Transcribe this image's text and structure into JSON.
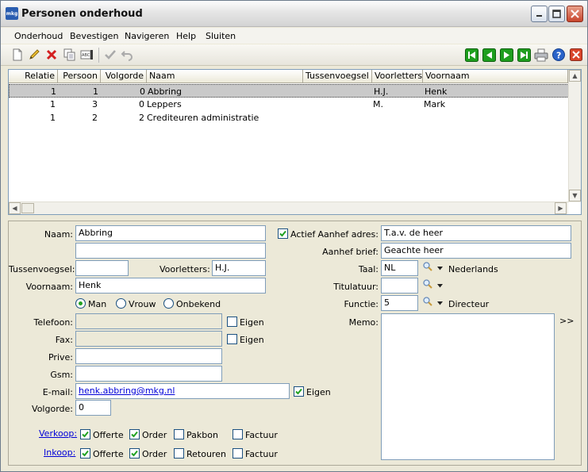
{
  "window": {
    "title": "Personen onderhoud",
    "app_icon_text": "mkg"
  },
  "menu": [
    "Onderhoud",
    "Bevestigen",
    "Navigeren",
    "Help",
    "Sluiten"
  ],
  "toolbar": {
    "left_icons": [
      "new-icon",
      "edit-icon",
      "delete-icon",
      "copy-icon",
      "rename-icon",
      "confirm-icon",
      "undo-icon"
    ],
    "right_icons": [
      "first-record-icon",
      "previous-record-icon",
      "next-record-icon",
      "last-record-icon",
      "print-icon",
      "help-icon",
      "close-icon"
    ]
  },
  "grid": {
    "columns": [
      "Relatie",
      "Persoon",
      "Volgorde",
      "Naam",
      "Tussenvoegsel",
      "Voorletters",
      "Voornaam"
    ],
    "rows": [
      {
        "relatie": "1",
        "persoon": "1",
        "volgorde": "0",
        "naam": "Abbring",
        "tussenvoegsel": "",
        "voorletters": "H.J.",
        "voornaam": "Henk",
        "selected": true
      },
      {
        "relatie": "1",
        "persoon": "3",
        "volgorde": "0",
        "naam": "Leppers",
        "tussenvoegsel": "",
        "voorletters": "M.",
        "voornaam": "Mark",
        "selected": false
      },
      {
        "relatie": "1",
        "persoon": "2",
        "volgorde": "2",
        "naam": "Crediteuren administratie",
        "tussenvoegsel": "",
        "voorletters": "",
        "voornaam": "",
        "selected": false
      }
    ]
  },
  "form": {
    "naam_label": "Naam:",
    "naam_value": "Abbring",
    "naam2_value": "",
    "actief_label": "Actief",
    "actief_checked": true,
    "tussenvoegsel_label": "Tussenvoegsel:",
    "tussenvoegsel_value": "",
    "voorletters_label": "Voorletters:",
    "voorletters_value": "H.J.",
    "voornaam_label": "Voornaam:",
    "voornaam_value": "Henk",
    "gender_options": [
      "Man",
      "Vrouw",
      "Onbekend"
    ],
    "gender_selected": "Man",
    "telefoon_label": "Telefoon:",
    "telefoon_value": "",
    "fax_label": "Fax:",
    "fax_value": "",
    "eigen_label": "Eigen",
    "prive_label": "Prive:",
    "prive_value": "",
    "gsm_label": "Gsm:",
    "gsm_value": "",
    "email_label": "E-mail:",
    "email_value": "henk.abbring@mkg.nl",
    "volgorde_label": "Volgorde:",
    "volgorde_value": "0",
    "aanhef_adres_label": "Aanhef adres:",
    "aanhef_adres_value": "T.a.v. de heer",
    "aanhef_brief_label": "Aanhef brief:",
    "aanhef_brief_value": "Geachte heer",
    "taal_label": "Taal:",
    "taal_value": "NL",
    "taal_desc": "Nederlands",
    "titulatuur_label": "Titulatuur:",
    "titulatuur_value": "",
    "functie_label": "Functie:",
    "functie_value": "5",
    "functie_desc": "Directeur",
    "memo_label": "Memo:",
    "memo_value": "",
    "memo_expand": ">>"
  },
  "verkoop": {
    "label": "Verkoop:",
    "items": [
      {
        "label": "Offerte",
        "checked": true
      },
      {
        "label": "Order",
        "checked": true
      },
      {
        "label": "Pakbon",
        "checked": false
      },
      {
        "label": "Factuur",
        "checked": false
      }
    ]
  },
  "inkoop": {
    "label": "Inkoop:",
    "items": [
      {
        "label": "Offerte",
        "checked": true
      },
      {
        "label": "Order",
        "checked": true
      },
      {
        "label": "Retouren",
        "checked": false
      },
      {
        "label": "Factuur",
        "checked": false
      }
    ]
  },
  "colors": {
    "selection": "#c9c9c9",
    "link": "#0000d8",
    "nav_green": "#1e9e1e",
    "check_green": "#21a121"
  }
}
